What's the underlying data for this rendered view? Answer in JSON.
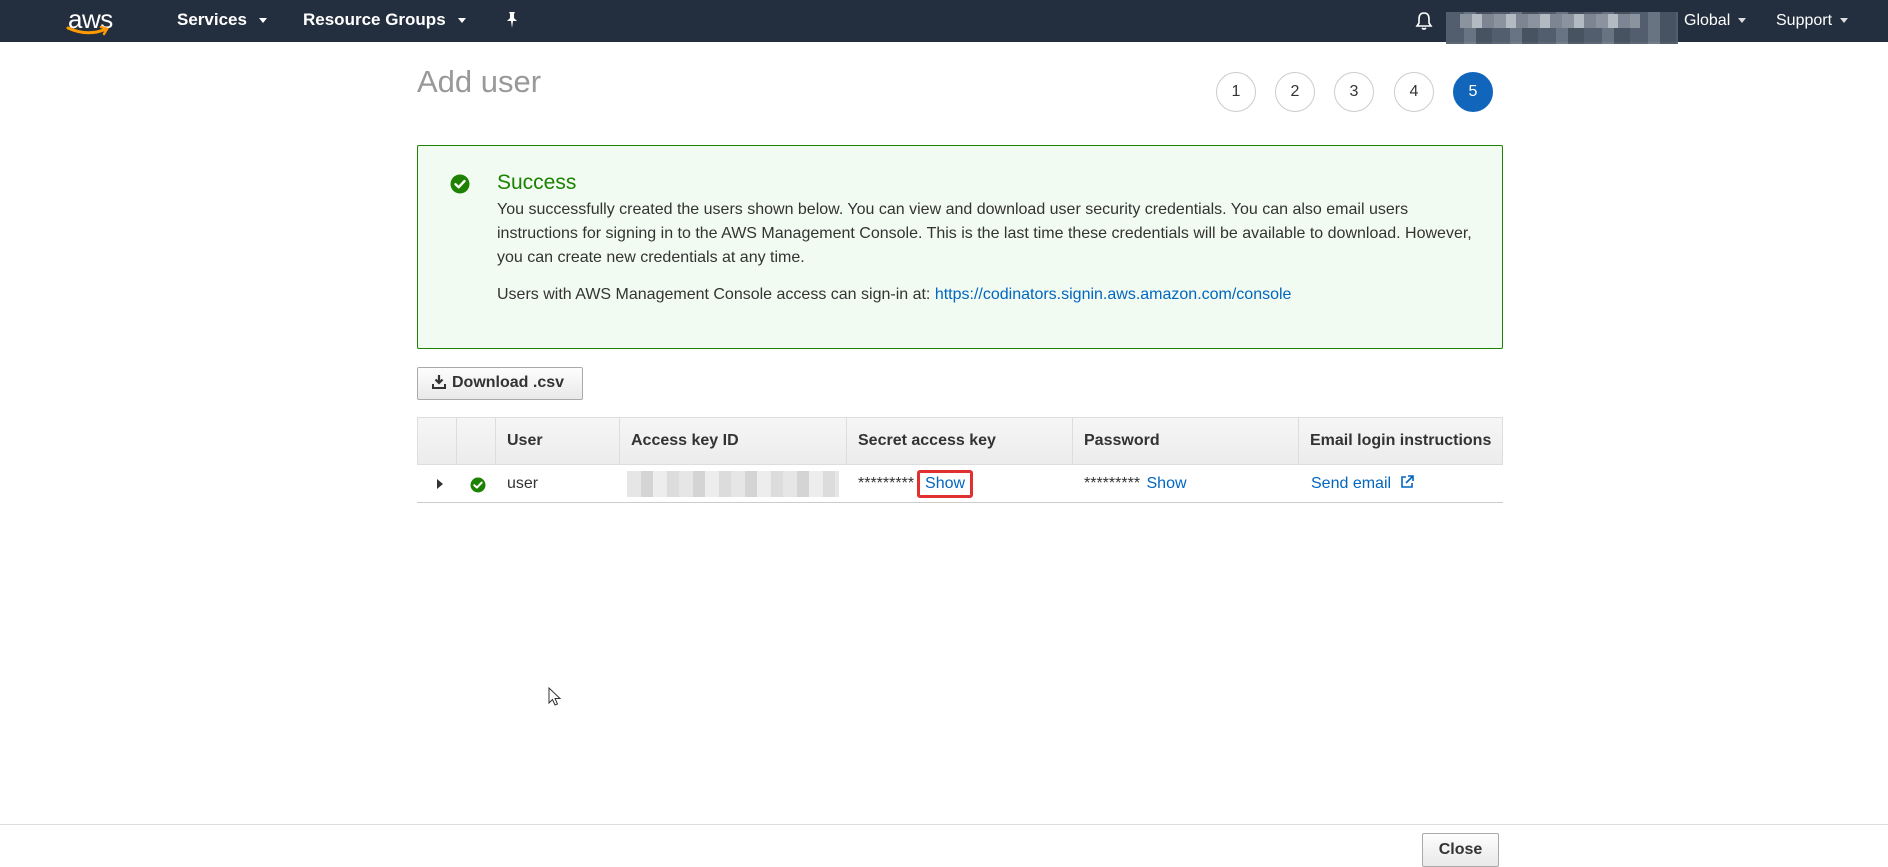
{
  "nav": {
    "logo": "aws",
    "services": "Services",
    "resource_groups": "Resource Groups",
    "region": "Global",
    "support": "Support"
  },
  "page": {
    "title": "Add user",
    "steps": [
      "1",
      "2",
      "3",
      "4",
      "5"
    ],
    "active_step": "5"
  },
  "alert": {
    "title": "Success",
    "body": "You successfully created the users shown below. You can view and download user security credentials. You can also email users instructions for signing in to the AWS Management Console. This is the last time these credentials will be available to download. However, you can create new credentials at any time.",
    "signin_prefix": "Users with AWS Management Console access can sign-in at:",
    "signin_url": "https://codinators.signin.aws.amazon.com/console"
  },
  "toolbar": {
    "download_label": "Download .csv"
  },
  "table": {
    "columns": [
      "User",
      "Access key ID",
      "Secret access key",
      "Password",
      "Email login instructions"
    ],
    "rows": [
      {
        "user": "user",
        "secret_masked": "*********",
        "secret_show": "Show",
        "password_masked": "*********",
        "password_show": "Show",
        "email_link": "Send email"
      }
    ]
  },
  "footer": {
    "close_label": "Close"
  },
  "colors": {
    "nav_bg": "#232f3e",
    "success": "#1d8102",
    "link": "#0066c0",
    "active_step": "#1166bb",
    "highlight": "#e03030"
  }
}
